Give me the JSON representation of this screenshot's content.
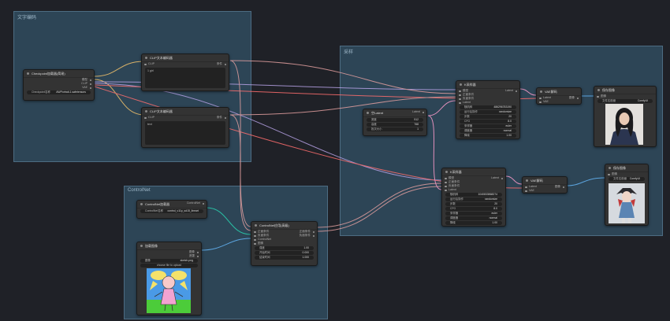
{
  "groups": {
    "top_left": "文字编码",
    "right": "采样",
    "controlnet": "ControlNet"
  },
  "checkpoint_loader": {
    "title": "Checkpoint加载器(简易)",
    "outputs": [
      "模型",
      "CLIP",
      "VAE"
    ],
    "widget_label": "Checkpoint名称",
    "widget_value": "AWPortrait-1.safetensors"
  },
  "clip_encode_pos": {
    "title": "CLIP文本编码器",
    "input": "CLIP",
    "output": "条件",
    "text": "1 girl"
  },
  "clip_encode_neg": {
    "title": "CLIP文本编码器",
    "input": "CLIP",
    "output": "条件",
    "text": "text"
  },
  "empty_latent": {
    "title": "空Latent",
    "output": "Latent",
    "widgets": [
      {
        "label": "宽度",
        "value": "512"
      },
      {
        "label": "高度",
        "value": "768"
      },
      {
        "label": "批次大小",
        "value": "1"
      }
    ]
  },
  "ksampler_top": {
    "title": "K采样器",
    "inputs": [
      "模型",
      "正面条件",
      "负面条件",
      "Latent"
    ],
    "output": "Latent",
    "widgets": [
      {
        "label": "随机种",
        "value": "486296783190"
      },
      {
        "label": "运行后操作",
        "value": "randomize"
      },
      {
        "label": "步数",
        "value": "20"
      },
      {
        "label": "CFG",
        "value": "8.0"
      },
      {
        "label": "采样器",
        "value": "euler"
      },
      {
        "label": "调度器",
        "value": "normal"
      },
      {
        "label": "降噪",
        "value": "1.00"
      }
    ]
  },
  "ksampler_bottom": {
    "title": "K采样器",
    "inputs": [
      "模型",
      "正面条件",
      "负面条件",
      "Latent"
    ],
    "output": "Latent",
    "widgets": [
      {
        "label": "随机种",
        "value": "1040833868274"
      },
      {
        "label": "运行后操作",
        "value": "randomize"
      },
      {
        "label": "步数",
        "value": "20"
      },
      {
        "label": "CFG",
        "value": "8.0"
      },
      {
        "label": "采样器",
        "value": "euler"
      },
      {
        "label": "调度器",
        "value": "normal"
      },
      {
        "label": "降噪",
        "value": "1.00"
      }
    ]
  },
  "vae_decode_top": {
    "title": "VAE解码",
    "inputs": [
      "Latent",
      "VAE"
    ],
    "output": "图像"
  },
  "vae_decode_bottom": {
    "title": "VAE解码",
    "inputs": [
      "Latent",
      "VAE"
    ],
    "output": "图像"
  },
  "save_image_top": {
    "title": "保存图像",
    "input": "图像",
    "widget_label": "文件名前缀",
    "widget_value": "ComfyUI"
  },
  "save_image_bottom": {
    "title": "保存图像",
    "input": "图像",
    "widget_label": "文件名前缀",
    "widget_value": "ComfyUI"
  },
  "controlnet_loader": {
    "title": "ControlNet加载器",
    "output": "ControlNet",
    "widget_label": "ControlNet名称",
    "widget_value": "control_v11p_sd15_lineart"
  },
  "load_image": {
    "title": "加载图像",
    "outputs": [
      "图像",
      "遮罩"
    ],
    "widget_label": "图像",
    "widget_value": "sketch.png",
    "upload_label": "choose file to upload"
  },
  "controlnet_apply": {
    "title": "ControlNet应用(高级)",
    "inputs": [
      "正面条件",
      "负面条件",
      "ControlNet",
      "图像"
    ],
    "outputs": [
      "正面条件",
      "负面条件"
    ],
    "widgets": [
      {
        "label": "强度",
        "value": "1.00"
      },
      {
        "label": "开始时间",
        "value": "0.000"
      },
      {
        "label": "结束时间",
        "value": "1.000"
      }
    ]
  },
  "colors": {
    "canvas": "#1f2127",
    "group": "#2d4556",
    "link_clip": "#f3c26b",
    "link_cond": "#e39f9f",
    "link_model": "#b6a1e5",
    "link_latent": "#ff9ccc",
    "link_vae": "#ff6e6e",
    "link_image": "#64b5f6",
    "link_control": "#2ad1b0"
  }
}
